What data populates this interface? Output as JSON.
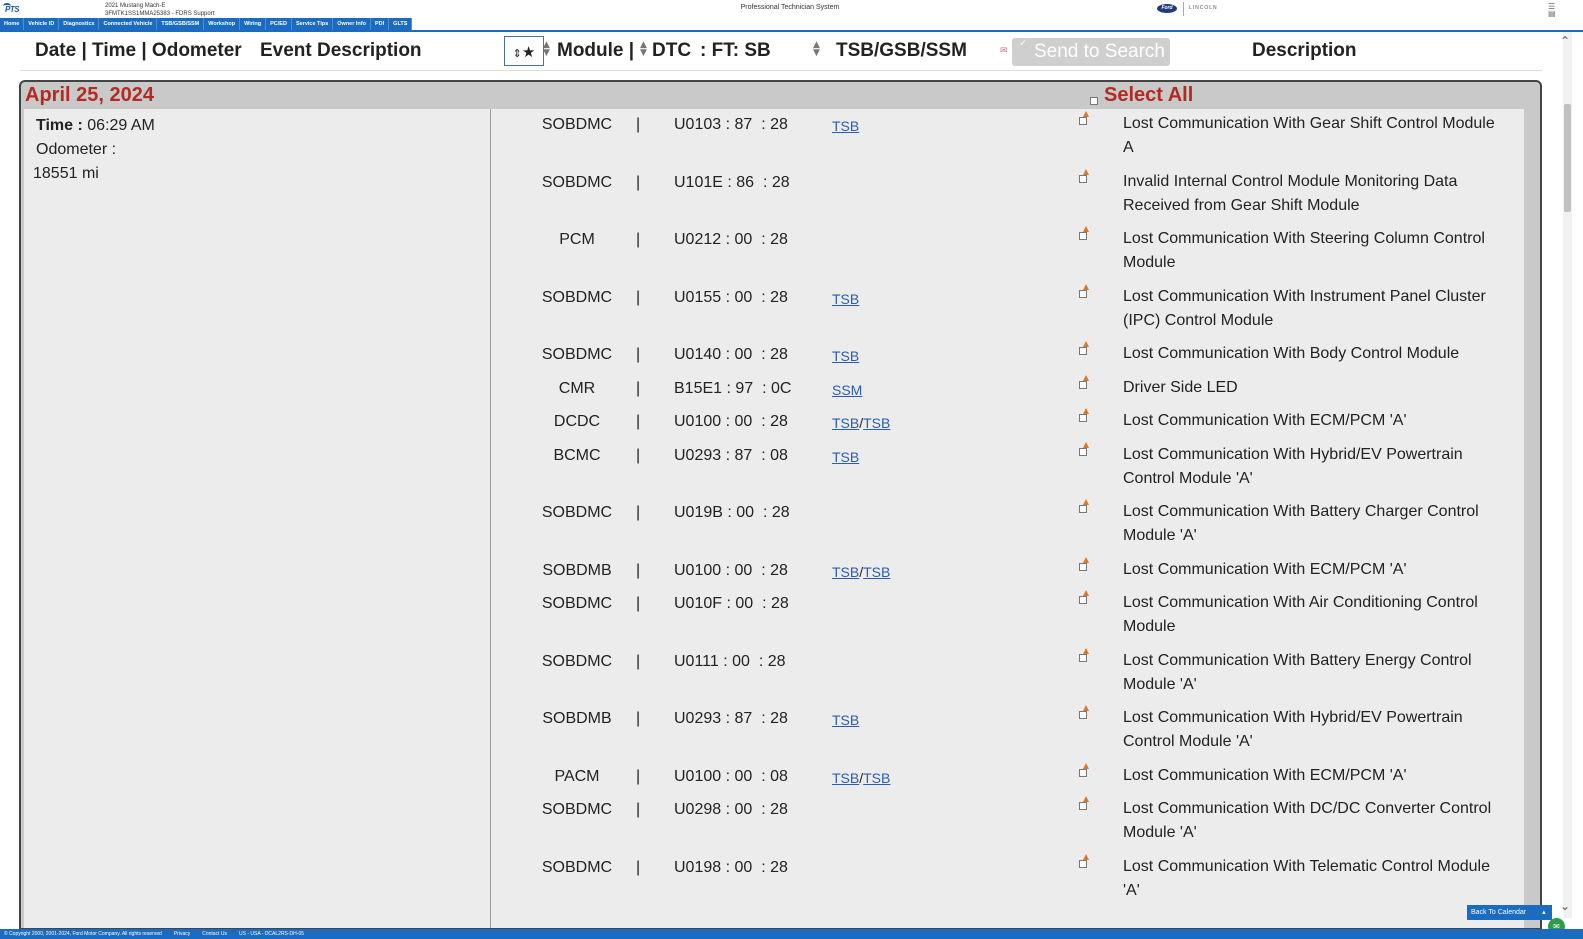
{
  "header": {
    "logo": "PTS",
    "vehicle_line1": "2021 Mustang Mach-E",
    "vehicle_line2": "3FMTK1SS1MMA25383 - FDRS Support",
    "system_title": "Professional Technician System",
    "brand1": "Ford",
    "brand2": "LINCOLN"
  },
  "nav": [
    "Home",
    "Vehicle ID",
    "Diagnostics",
    "Connected Vehicle",
    "TSB/GSB/SSM",
    "Workshop",
    "Wiring",
    "PC/ED",
    "Service Tips",
    "Owner Info",
    "PDI",
    "GLTS"
  ],
  "columns": {
    "date_time_odo": "Date | Time | Odometer",
    "event_desc": "Event Description",
    "star": "★",
    "module": "Module |",
    "dtc": "DTC",
    "ft_sb": ": FT: SB",
    "tsb": "TSB/GSB/SSM",
    "send": "Send to Search",
    "description": "Description"
  },
  "event": {
    "date": "April 25, 2024",
    "select_all": "Select All",
    "time_label": "Time :",
    "time_value": "06:29 AM",
    "odometer_label": "Odometer :",
    "odometer_value": "18551 mi"
  },
  "rows": [
    {
      "module": "SOBDMC",
      "dtc": "U0103",
      "ft": "87",
      "sb": "28",
      "links": [
        "TSB"
      ],
      "desc": "Lost Communication With Gear Shift Control Module A"
    },
    {
      "module": "SOBDMC",
      "dtc": "U101E",
      "ft": "86",
      "sb": "28",
      "links": [],
      "desc": "Invalid Internal Control Module Monitoring Data Received from Gear Shift Module"
    },
    {
      "module": "PCM",
      "dtc": "U0212",
      "ft": "00",
      "sb": "28",
      "links": [],
      "desc": "Lost Communication With Steering Column Control Module"
    },
    {
      "module": "SOBDMC",
      "dtc": "U0155",
      "ft": "00",
      "sb": "28",
      "links": [
        "TSB"
      ],
      "desc": "Lost Communication With Instrument Panel Cluster (IPC) Control Module"
    },
    {
      "module": "SOBDMC",
      "dtc": "U0140",
      "ft": "00",
      "sb": "28",
      "links": [
        "TSB"
      ],
      "desc": "Lost Communication With Body Control Module"
    },
    {
      "module": "CMR",
      "dtc": "B15E1",
      "ft": "97",
      "sb": "0C",
      "links": [
        "SSM"
      ],
      "desc": "Driver Side LED"
    },
    {
      "module": "DCDC",
      "dtc": "U0100",
      "ft": "00",
      "sb": "28",
      "links": [
        "TSB",
        "TSB"
      ],
      "desc": "Lost Communication With ECM/PCM 'A'"
    },
    {
      "module": "BCMC",
      "dtc": "U0293",
      "ft": "87",
      "sb": "08",
      "links": [
        "TSB"
      ],
      "desc": "Lost Communication With Hybrid/EV Powertrain Control Module 'A'"
    },
    {
      "module": "SOBDMC",
      "dtc": "U019B",
      "ft": "00",
      "sb": "28",
      "links": [],
      "desc": "Lost Communication With Battery Charger Control Module 'A'"
    },
    {
      "module": "SOBDMB",
      "dtc": "U0100",
      "ft": "00",
      "sb": "28",
      "links": [
        "TSB",
        "TSB"
      ],
      "desc": "Lost Communication With ECM/PCM 'A'"
    },
    {
      "module": "SOBDMC",
      "dtc": "U010F",
      "ft": "00",
      "sb": "28",
      "links": [],
      "desc": "Lost Communication With Air Conditioning Control Module"
    },
    {
      "module": "SOBDMC",
      "dtc": "U0111",
      "ft": "00",
      "sb": "28",
      "links": [],
      "desc": "Lost Communication With Battery Energy Control Module 'A'"
    },
    {
      "module": "SOBDMB",
      "dtc": "U0293",
      "ft": "87",
      "sb": "28",
      "links": [
        "TSB"
      ],
      "desc": "Lost Communication With Hybrid/EV Powertrain Control Module 'A'"
    },
    {
      "module": "PACM",
      "dtc": "U0100",
      "ft": "00",
      "sb": "08",
      "links": [
        "TSB",
        "TSB"
      ],
      "desc": "Lost Communication With ECM/PCM 'A'"
    },
    {
      "module": "SOBDMC",
      "dtc": "U0298",
      "ft": "00",
      "sb": "28",
      "links": [],
      "desc": "Lost Communication With DC/DC Converter Control Module 'A'"
    },
    {
      "module": "SOBDMC",
      "dtc": "U0198",
      "ft": "00",
      "sb": "28",
      "links": [],
      "desc": "Lost Communication With Telematic Control Module 'A'"
    }
  ],
  "back_to_calendar": "Back To Calendar",
  "footer": [
    "© Copyright 2000, 2001-2024, Ford Motor Company. All rights reserved",
    "Privacy",
    "Contact Us",
    "US - USA - DCAL2RS-DH-05"
  ]
}
